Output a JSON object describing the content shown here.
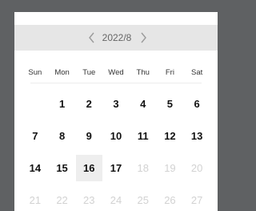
{
  "calendar": {
    "month_label": "2022/8",
    "prev_icon": "chevron-left-icon",
    "next_icon": "chevron-right-icon",
    "weekdays": [
      "Sun",
      "Mon",
      "Tue",
      "Wed",
      "Thu",
      "Fri",
      "Sat"
    ],
    "weeks": [
      [
        {
          "day": "",
          "state": "empty"
        },
        {
          "day": "1",
          "state": "normal"
        },
        {
          "day": "2",
          "state": "normal"
        },
        {
          "day": "3",
          "state": "normal"
        },
        {
          "day": "4",
          "state": "normal"
        },
        {
          "day": "5",
          "state": "normal"
        },
        {
          "day": "6",
          "state": "normal"
        }
      ],
      [
        {
          "day": "7",
          "state": "normal"
        },
        {
          "day": "8",
          "state": "normal"
        },
        {
          "day": "9",
          "state": "normal"
        },
        {
          "day": "10",
          "state": "normal"
        },
        {
          "day": "11",
          "state": "normal"
        },
        {
          "day": "12",
          "state": "normal"
        },
        {
          "day": "13",
          "state": "normal"
        }
      ],
      [
        {
          "day": "14",
          "state": "normal"
        },
        {
          "day": "15",
          "state": "normal"
        },
        {
          "day": "16",
          "state": "selected"
        },
        {
          "day": "17",
          "state": "normal"
        },
        {
          "day": "18",
          "state": "muted"
        },
        {
          "day": "19",
          "state": "muted"
        },
        {
          "day": "20",
          "state": "muted"
        }
      ],
      [
        {
          "day": "21",
          "state": "muted"
        },
        {
          "day": "22",
          "state": "muted"
        },
        {
          "day": "23",
          "state": "muted"
        },
        {
          "day": "24",
          "state": "muted"
        },
        {
          "day": "25",
          "state": "muted"
        },
        {
          "day": "26",
          "state": "muted"
        },
        {
          "day": "27",
          "state": "muted"
        }
      ]
    ]
  },
  "colors": {
    "backdrop": "#5f6163",
    "header_bg": "#e6e6e6",
    "selected_bg": "#eeeeee",
    "muted_text": "#d2d2d2"
  }
}
